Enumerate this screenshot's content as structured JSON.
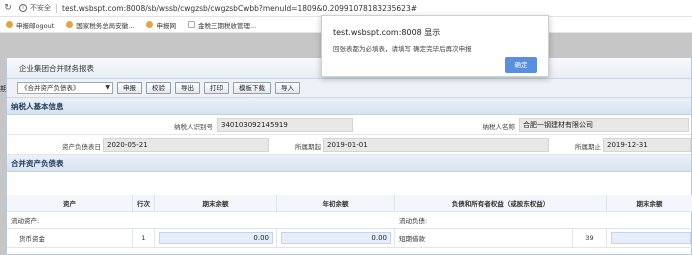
{
  "browser": {
    "security_label": "不安全",
    "url": "test.wsbspt.com:8008/sb/wssb/cwgzsb/cwgzsbCwbb?menuId=1809&0.20991078183235623#",
    "bookmarks": [
      "申报邮ogout",
      "国家税务总局安徽...",
      "申报网",
      "金税三期税收管理..."
    ]
  },
  "left_stub": "期",
  "panel": {
    "title": "企业集团合并财务报表",
    "report_select": "《合并资产负债表》",
    "buttons": [
      "申报",
      "校验",
      "导出",
      "打印",
      "模板下载",
      "导入"
    ]
  },
  "taxpayer": {
    "section_title": "纳税人基本信息",
    "id_label": "纳税人识别号",
    "id_value": "340103092145919",
    "name_label": "纳税人名称",
    "name_value": "合肥一钢建材有限公司",
    "date_label": "资产负债表日",
    "date_value": "2020-05-21",
    "period_start_label": "所属期起",
    "period_start_value": "2019-01-01",
    "period_end_label": "所属期止",
    "period_end_value": "2019-12-31"
  },
  "balance_sheet": {
    "section_title": "合并资产负债表",
    "headers": {
      "asset": "资产",
      "line_no": "行次",
      "period_end": "期末余额",
      "year_start": "年初余额",
      "liability": "负债和所有者权益（或股东权益）",
      "period_end_right": "期末余额"
    },
    "current_assets_label": "流动资产:",
    "current_liabilities_label": "流动负债:",
    "row1": {
      "asset_name": "货币资金",
      "line_no": "1",
      "period_end": "0.00",
      "year_start": "0.00",
      "liability_name": "短期借款",
      "liability_line_no": "39"
    }
  },
  "dialog": {
    "title": "test.wsbspt.com:8008 显示",
    "message": "回张表都为必填表，请填写 确定完毕后再次申报",
    "ok_label": "确定"
  }
}
